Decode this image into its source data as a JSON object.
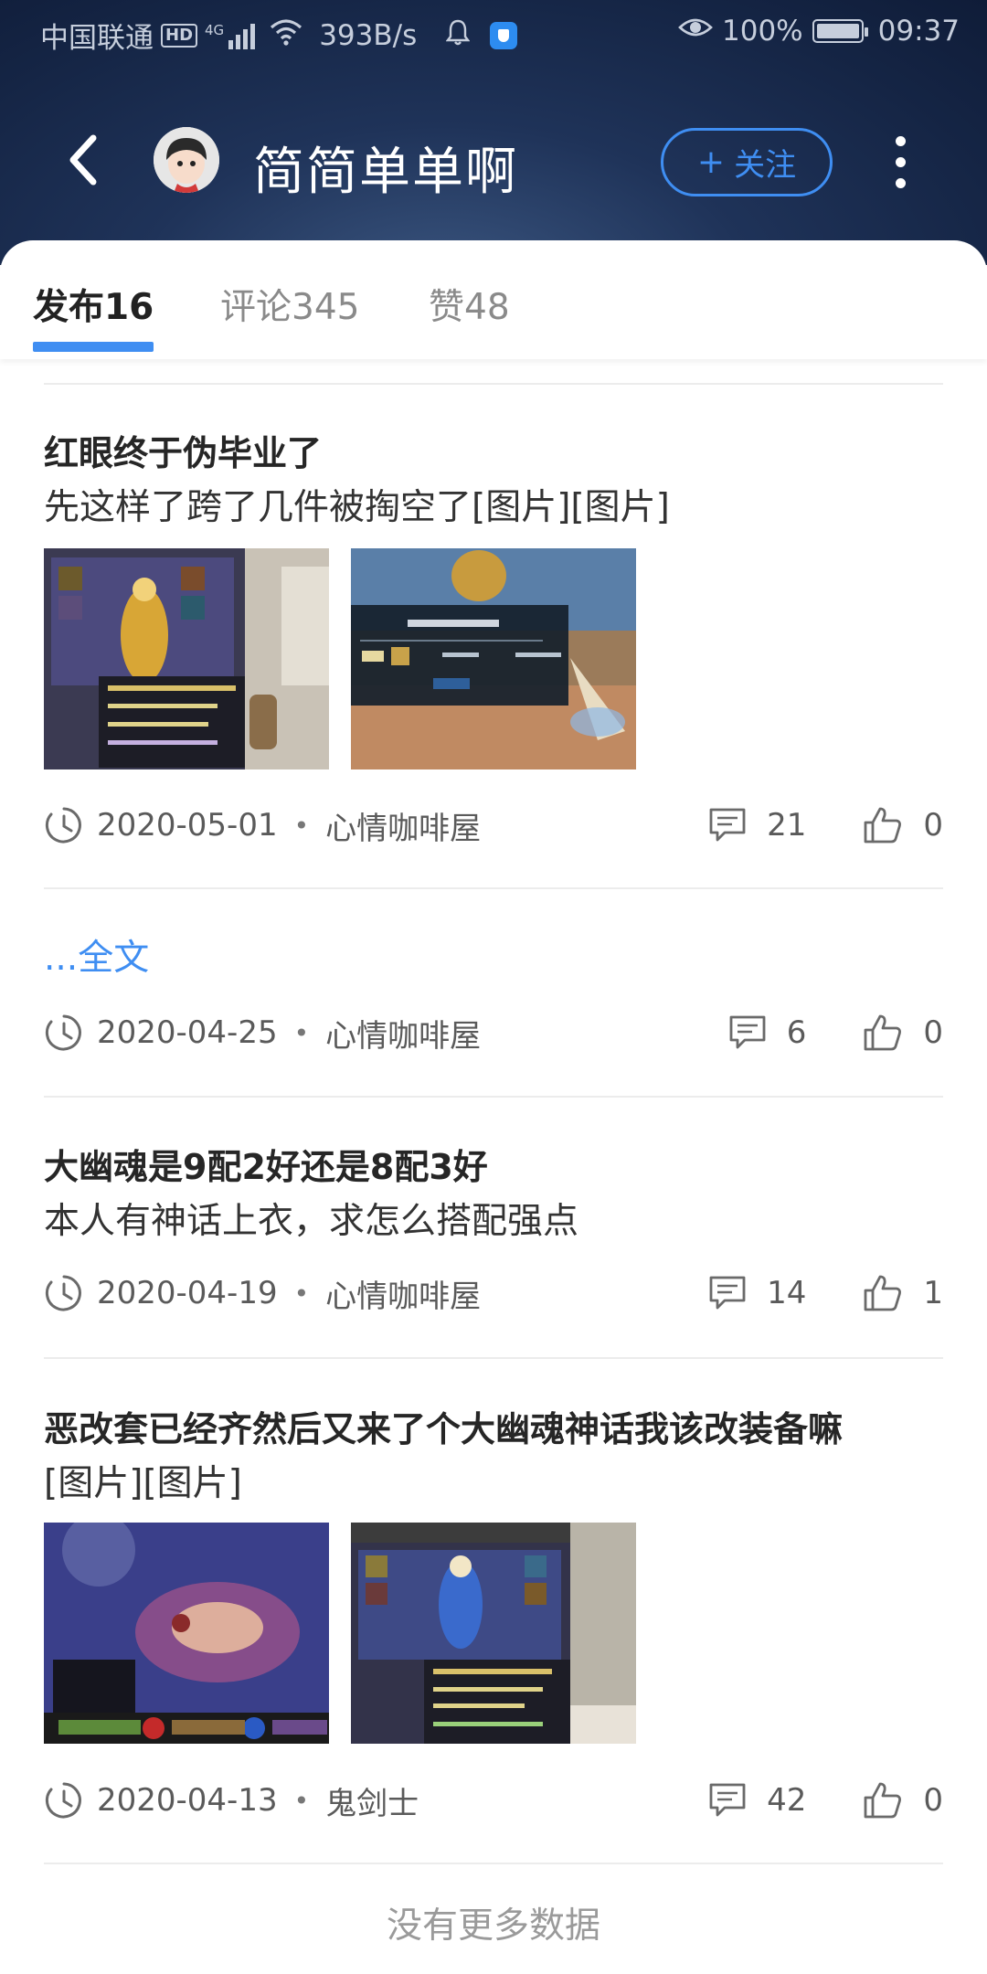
{
  "status_bar": {
    "carrier": "中国联通",
    "hd": "HD",
    "network": "4G",
    "speed": "393B/s",
    "battery": "100%",
    "time": "09:37"
  },
  "header": {
    "username": "简简单单啊",
    "follow_label": "关注",
    "accent_color": "#3f8ef2"
  },
  "tabs": [
    {
      "label": "发布16",
      "active": true
    },
    {
      "label": "评论345",
      "active": false
    },
    {
      "label": "赞48",
      "active": false
    }
  ],
  "posts": [
    {
      "title": "红眼终于伪毕业了",
      "body": "先这样了跨了几件被掏空了[图片][图片]",
      "date": "2020-05-01",
      "category": "心情咖啡屋",
      "comments": "21",
      "likes": "0"
    },
    {
      "link": "...全文",
      "date": "2020-04-25",
      "category": "心情咖啡屋",
      "comments": "6",
      "likes": "0"
    },
    {
      "title": "大幽魂是9配2好还是8配3好",
      "body": "本人有神话上衣，求怎么搭配强点",
      "date": "2020-04-19",
      "category": "心情咖啡屋",
      "comments": "14",
      "likes": "1"
    },
    {
      "title": "恶改套已经齐然后又来了个大幽魂神话我该改装备嘛",
      "body": "[图片][图片]",
      "date": "2020-04-13",
      "category": "鬼剑士",
      "comments": "42",
      "likes": "0"
    }
  ],
  "footer": {
    "no_more": "没有更多数据"
  }
}
